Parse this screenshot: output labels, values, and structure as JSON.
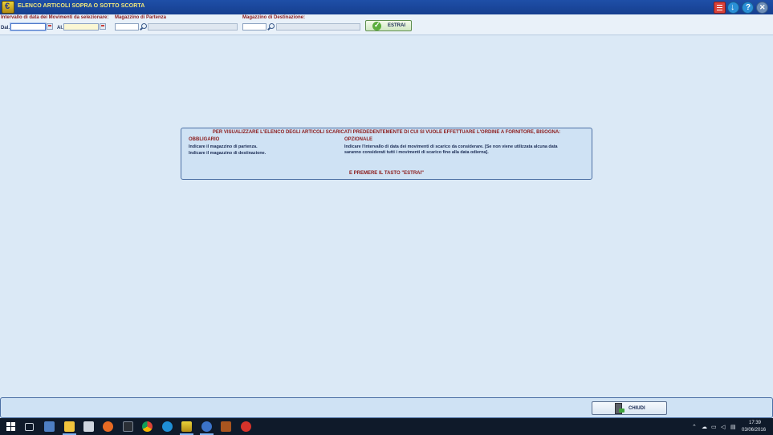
{
  "window": {
    "title": "ELENCO ARTICOLI SOPRA O SOTTO SCORTA",
    "icons": [
      "app-logo-icon",
      "calculator-icon",
      "download-icon",
      "help-icon",
      "close-icon"
    ]
  },
  "filters": {
    "date_range_label": "Intervallo di data dei Movimenti da selezionare:",
    "dal_label": "Dal.",
    "al_label": "Al.",
    "dal_value": "",
    "al_value": "",
    "mag_partenza_label": "Magazzino di Partenza",
    "mag_partenza_code": "",
    "mag_partenza_desc": "",
    "mag_destinazione_label": "Magazzino di Destinazione:",
    "mag_destinazione_code": "",
    "mag_destinazione_desc": "",
    "estrai_label": "ESTRAI"
  },
  "info": {
    "title": "PER VISUALIZZARE L'ELENCO DEGLI ARTICOLI SCARICATI PREDEDENTEMENTE DI CUI SI VUOLE EFFETTUARE L'ORDINE A FORNITORE, BISOGNA:",
    "obbligario_header": "OBBLIGARIO",
    "obbligario_lines": [
      "Indicare il magazzino di partenza.",
      "Indicare il magazzino di destinazione."
    ],
    "opzionale_header": "OPZIONALE",
    "opzionale_lines": [
      "Indicare l'intervallo di data dei movimenti di scarico da considerare. [Se  non  viene utilizzata alcuna data",
      "saranno considerati tutti i movimenti di scarico fino alla data odierna]."
    ],
    "footer": "E PREMERE IL TASTO \"ESTRAI\""
  },
  "bottom": {
    "chiudi_label": "CHIUDI"
  },
  "taskbar": {
    "time": "17:39",
    "date": "03/06/2016",
    "colors": {
      "background": "#0f1a2a",
      "accent": "#7fb2f0"
    }
  },
  "colors": {
    "titlebar": "#1f4fa8",
    "title_text": "#f4ea7c",
    "label_red": "#8b1a1a",
    "label_dark": "#1b2c55",
    "background": "#dbe9f6"
  }
}
